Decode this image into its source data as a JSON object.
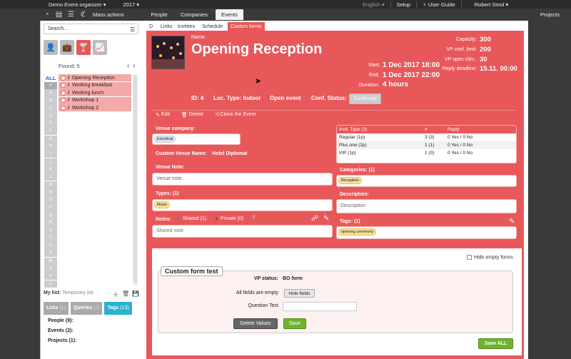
{
  "topbar": {
    "app_name": "Demo Event organizer",
    "year": "2017",
    "language": "English",
    "setup": "Setup",
    "user_guide": "User Guide",
    "user": "Robert Smol"
  },
  "toolbar": {
    "mass_actions": "Mass actions",
    "projects": "Projects"
  },
  "main_tabs": [
    "People",
    "Companies",
    "Events"
  ],
  "sidebar": {
    "search_placeholder": "Search...",
    "found_label": "Found:",
    "found_count": "5",
    "letters": [
      "ALL",
      "#",
      "A",
      "B",
      "C",
      "D",
      "E",
      "F",
      "G",
      "H",
      "I",
      "J",
      "K",
      "L",
      "M",
      "N",
      "O",
      "P",
      "Q",
      "R",
      "S",
      "T",
      "U",
      "V",
      "W",
      "X",
      "Y",
      "Z"
    ],
    "items": [
      {
        "label": "Opening Reception"
      },
      {
        "label": "Working breakfast"
      },
      {
        "label": "Working lunch"
      },
      {
        "label": "Workshop 1"
      },
      {
        "label": "Workshop 2"
      }
    ],
    "mylist_label": "My list:",
    "mylist_value": "Temporary list",
    "bottom_tabs": [
      {
        "label": "Lists",
        "count": "(1)"
      },
      {
        "label": "Queries",
        "count": "(2)"
      },
      {
        "label": "Tags",
        "count": "(13)"
      }
    ],
    "lines": [
      "People (9):",
      "Events (2):",
      "Projects (1):"
    ]
  },
  "subtabs": [
    "D",
    "Links",
    "Invitees",
    "Schedule",
    "Custom forms"
  ],
  "event": {
    "name_label": "Name:",
    "name": "Opening Reception",
    "start_label": "Start:",
    "start": "1 Dec 2017 18:00",
    "end_label": "End:",
    "end": "1 Dec 2017 22:00",
    "duration_label": "Duration:",
    "duration": "4 hours",
    "capacity_label": "Capacity:",
    "capacity": "300",
    "vp_limit_label": "VP conf. limit:",
    "vp_limit": "200",
    "vp_open_label": "VP open clim.:",
    "vp_open": "30",
    "deadline_label": "Reply deadline:",
    "deadline": "15.11. 00:00",
    "id_text": "ID: 4",
    "loc_text": "Loc. Type: Indoor",
    "open_text": "Open event",
    "conf_label": "Conf. Status:",
    "conf_value": "Confirmed"
  },
  "actions": {
    "edit": "Edit",
    "delete": "Delete",
    "clone": "Clone the Event"
  },
  "venue": {
    "company_label": "Venue company:",
    "company_pill": "Eventival",
    "custom_name_label": "Custom Venue Name:",
    "custom_name": "Hotel Diplomat",
    "note_label": "Venue Note:",
    "note_placeholder": "Venue note",
    "types_label": "Types: (1)",
    "types_pill": "Music",
    "notes_label": "Notes:",
    "shared_label": "Shared (1)",
    "private_label": "Private (0)",
    "help": "?",
    "shared_note": "Shared note"
  },
  "invitations": {
    "header": [
      "Invit. Type (3)",
      "#",
      "Reply"
    ],
    "rows": [
      {
        "type": "Regular (1p)",
        "count": "3 (3)",
        "reply": "0 Yes / 0 No"
      },
      {
        "type": "Plus one (2p)",
        "count": "1 (1)",
        "reply": "0 Yes / 0 No"
      },
      {
        "type": "VIP (1p)",
        "count": "1 (0)",
        "reply": "0 Yes / 0 No"
      }
    ]
  },
  "categories": {
    "label": "Categories: (1)",
    "pill": "Reception"
  },
  "description": {
    "label": "Description:",
    "placeholder": "Description"
  },
  "tags": {
    "label": "Tags: (1)",
    "pill": "opening ceremony"
  },
  "custom_form": {
    "hide_empty": "Hide empty forms",
    "legend": "Custom form test",
    "vp_status_label": "VP status:",
    "vp_status": "BO form",
    "all_empty_label": "All fields are empty",
    "hide_fields": "Hide fields",
    "question_label": "Question Test",
    "delete_values": "Delete Values",
    "save": "Save",
    "save_all": "Save ALL"
  }
}
